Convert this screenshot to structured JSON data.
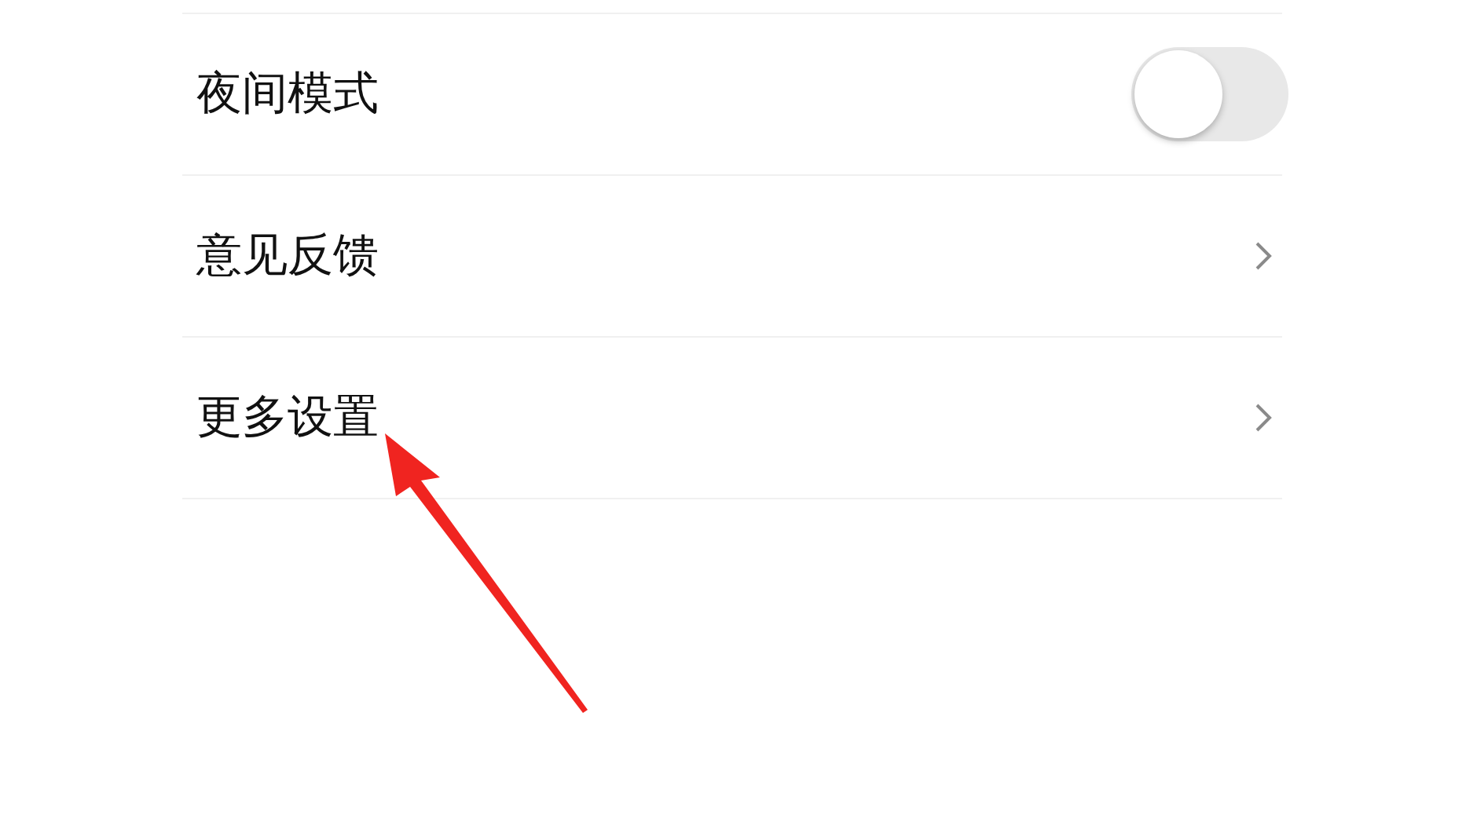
{
  "settings": [
    {
      "kind": "toggle",
      "label": "夜间模式",
      "on": false
    },
    {
      "kind": "link",
      "label": "意见反馈"
    },
    {
      "kind": "link",
      "label": "更多设置"
    }
  ]
}
